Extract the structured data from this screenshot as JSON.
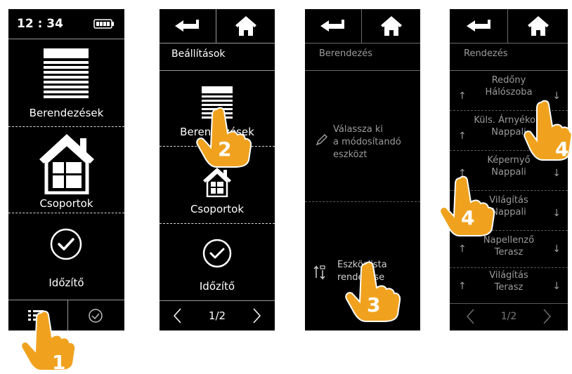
{
  "screen1": {
    "time": "12 : 34",
    "items": [
      {
        "label": "Berendezések",
        "icon": "shutter-icon"
      },
      {
        "label": "Csoportok",
        "icon": "house-icon"
      },
      {
        "label": "Időzítő",
        "icon": "check-circle-icon"
      }
    ],
    "bottom_icons": [
      "list-icon",
      "clock-check-icon"
    ]
  },
  "screen2": {
    "title": "Beállítások",
    "items": [
      {
        "label": "Berendezések",
        "icon": "shutter-icon"
      },
      {
        "label": "Csoportok",
        "icon": "house-icon"
      },
      {
        "label": "Időzítő",
        "icon": "check-circle-icon"
      }
    ],
    "pager": "1/2"
  },
  "screen3": {
    "title": "Berendezés",
    "hint_lines": [
      "Válassza ki",
      "a módosítandó",
      "eszközt"
    ],
    "sort_lines": [
      "Eszközlista",
      "rendezése"
    ]
  },
  "screen4": {
    "title": "Rendezés",
    "rows": [
      {
        "line1": "Redőny",
        "line2": "Hálószoba"
      },
      {
        "line1": "Küls. Árnyékoló",
        "line2": "Nappali"
      },
      {
        "line1": "Képernyő",
        "line2": "Nappali"
      },
      {
        "line1": "Világítás",
        "line2": "Nappali"
      },
      {
        "line1": "Napellenző",
        "line2": "Terasz"
      },
      {
        "line1": "Világítás",
        "line2": "Terasz"
      }
    ],
    "pager": "1/2"
  },
  "steps": [
    "1",
    "2",
    "3",
    "4",
    "4"
  ],
  "colors": {
    "hand_orange": "#f0a21f",
    "hand_orange_dark": "#d98c10",
    "screen_bg": "#000000"
  }
}
